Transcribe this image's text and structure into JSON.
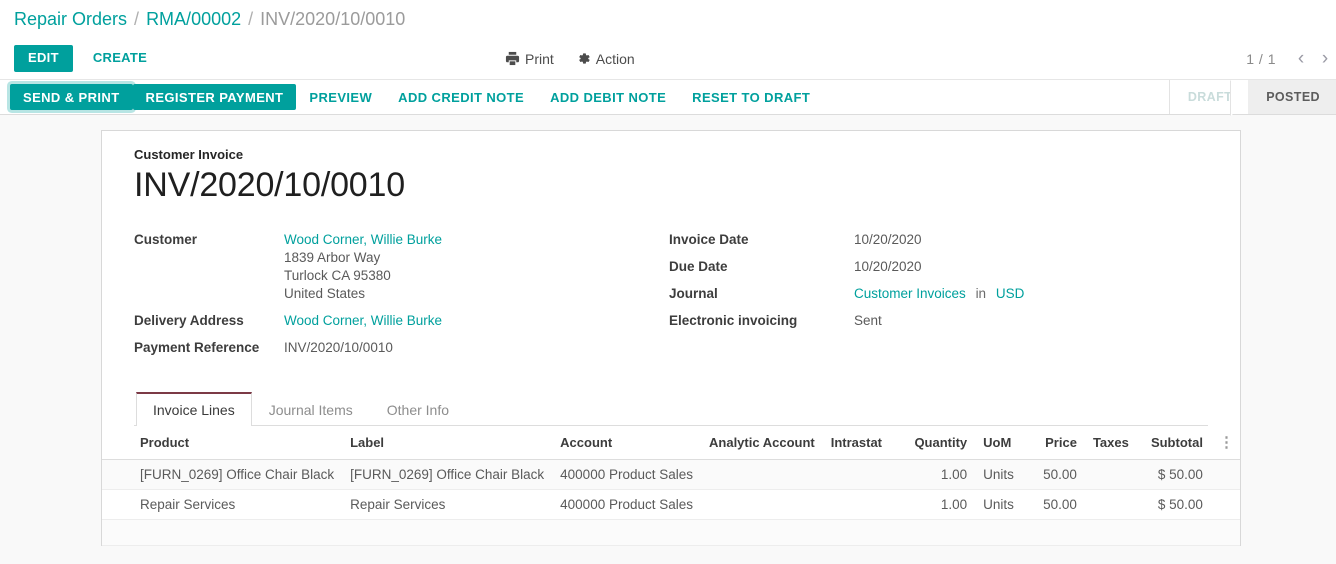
{
  "breadcrumb": {
    "items": [
      {
        "label": "Repair Orders",
        "type": "link"
      },
      {
        "label": "RMA/00002",
        "type": "link"
      },
      {
        "label": "INV/2020/10/0010",
        "type": "current"
      }
    ],
    "separator": "/"
  },
  "control_panel": {
    "edit_label": "EDIT",
    "create_label": "CREATE",
    "print_label": "Print",
    "action_label": "Action",
    "pager_count": "1 / 1",
    "prev_icon": "chevron-left-icon",
    "next_icon": "chevron-right-icon"
  },
  "status_bar": {
    "buttons": [
      {
        "label": "SEND & PRINT",
        "style": "primary-focused"
      },
      {
        "label": "REGISTER PAYMENT",
        "style": "primary"
      },
      {
        "label": "PREVIEW",
        "style": "link"
      },
      {
        "label": "ADD CREDIT NOTE",
        "style": "link"
      },
      {
        "label": "ADD DEBIT NOTE",
        "style": "link"
      },
      {
        "label": "RESET TO DRAFT",
        "style": "link"
      }
    ],
    "states": [
      {
        "label": "DRAFT",
        "active": false
      },
      {
        "label": "POSTED",
        "active": true
      }
    ]
  },
  "sheet": {
    "form_label": "Customer Invoice",
    "title": "INV/2020/10/0010",
    "left_fields": {
      "customer_label": "Customer",
      "customer_name": "Wood Corner, Willie Burke",
      "customer_address": [
        "1839 Arbor Way",
        "Turlock CA 95380",
        "United States"
      ],
      "delivery_label": "Delivery Address",
      "delivery_value": "Wood Corner, Willie Burke",
      "payment_ref_label": "Payment Reference",
      "payment_ref_value": "INV/2020/10/0010"
    },
    "right_fields": {
      "invoice_date_label": "Invoice Date",
      "invoice_date_value": "10/20/2020",
      "due_date_label": "Due Date",
      "due_date_value": "10/20/2020",
      "journal_label": "Journal",
      "journal_value": "Customer Invoices",
      "journal_in": "in",
      "journal_currency": "USD",
      "einvoicing_label": "Electronic invoicing",
      "einvoicing_value": "Sent"
    }
  },
  "notebook": {
    "tabs": [
      {
        "label": "Invoice Lines",
        "active": true
      },
      {
        "label": "Journal Items",
        "active": false
      },
      {
        "label": "Other Info",
        "active": false
      }
    ]
  },
  "lines_table": {
    "columns": [
      "Product",
      "Label",
      "Account",
      "Analytic Account",
      "Intrastat",
      "Quantity",
      "UoM",
      "Price",
      "Taxes",
      "Subtotal"
    ],
    "optional_columns_icon": "vertical-ellipsis-icon",
    "rows": [
      {
        "product": "[FURN_0269] Office Chair Black",
        "label": "[FURN_0269] Office Chair Black",
        "account": "400000 Product Sales",
        "analytic_account": "",
        "intrastat": "",
        "quantity": "1.00",
        "uom": "Units",
        "price": "50.00",
        "taxes": "",
        "subtotal": "$ 50.00"
      },
      {
        "product": "Repair Services",
        "label": "Repair Services",
        "account": "400000 Product Sales",
        "analytic_account": "",
        "intrastat": "",
        "quantity": "1.00",
        "uom": "Units",
        "price": "50.00",
        "taxes": "",
        "subtotal": "$ 50.00"
      }
    ]
  },
  "colors": {
    "accent_teal": "#00a09d",
    "page_background": "#f9f9f9",
    "active_tab_accent": "#7c3a46"
  }
}
